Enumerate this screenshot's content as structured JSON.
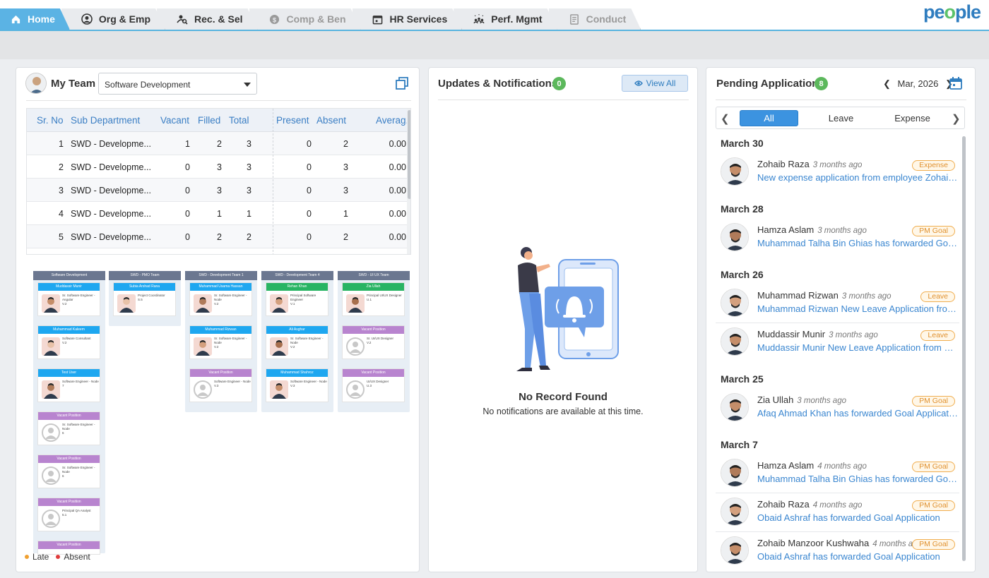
{
  "nav": {
    "tabs": [
      {
        "label": "Home",
        "icon": "home-icon",
        "state": "active"
      },
      {
        "label": "Org & Emp",
        "icon": "user-circle-icon",
        "state": "normal"
      },
      {
        "label": "Rec. & Sel",
        "icon": "user-search-icon",
        "state": "normal"
      },
      {
        "label": "Comp & Ben",
        "icon": "dollar-icon",
        "state": "disabled"
      },
      {
        "label": "HR Services",
        "icon": "calendar-icon",
        "state": "normal"
      },
      {
        "label": "Perf. Mgmt",
        "icon": "team-stars-icon",
        "state": "normal"
      },
      {
        "label": "Conduct",
        "icon": "document-icon",
        "state": "disabled"
      }
    ],
    "brand": {
      "pre": "pe",
      "mid": "o",
      "post": "ple"
    },
    "colors": {
      "active_tab": "#5bb3e4",
      "brand_blue": "#2f7dbf",
      "brand_green": "#5bc26a"
    }
  },
  "team": {
    "title": "My Team",
    "department": "Software Development",
    "columns": [
      "Sr. No",
      "Sub Department",
      "Vacant",
      "Filled",
      "Total",
      "Present",
      "Absent",
      "Averag..."
    ],
    "rows": [
      [
        "1",
        "SWD - Developme...",
        "1",
        "2",
        "3",
        "0",
        "2",
        "0.00"
      ],
      [
        "2",
        "SWD - Developme...",
        "0",
        "3",
        "3",
        "0",
        "3",
        "0.00"
      ],
      [
        "3",
        "SWD - Developme...",
        "0",
        "3",
        "3",
        "0",
        "3",
        "0.00"
      ],
      [
        "4",
        "SWD - Developme...",
        "0",
        "1",
        "1",
        "0",
        "1",
        "0.00"
      ],
      [
        "5",
        "SWD - Developme...",
        "0",
        "2",
        "2",
        "0",
        "2",
        "0.00"
      ]
    ],
    "org": [
      {
        "team": "Software Development",
        "members": [
          {
            "name": "Muddassir Munir",
            "role": "Sr. Software Engineer - Angular",
            "code": "V.2",
            "kind": "blue"
          },
          {
            "name": "Muhammad Kaleem",
            "role": "Software Consultant",
            "code": "V.2",
            "kind": "blue"
          },
          {
            "name": "Test User",
            "role": "Software Engineer - Node",
            "code": "7",
            "kind": "blue"
          },
          {
            "name": "Vacant Position",
            "role": "Sr. Software Engineer - Node",
            "code": "6",
            "kind": "vacant"
          },
          {
            "name": "Vacant Position",
            "role": "Sr. Software Engineer - Node",
            "code": "6",
            "kind": "vacant"
          },
          {
            "name": "Vacant Position",
            "role": "Principal QA Analyst",
            "code": "5.1",
            "kind": "vacant"
          },
          {
            "name": "Vacant Position",
            "role": "",
            "code": "",
            "kind": "vacant"
          }
        ]
      },
      {
        "team": "SWD - PMO Team",
        "members": [
          {
            "name": "Subia Arshad Rana",
            "role": "Project Coordinator",
            "code": "S.5",
            "kind": "blue"
          }
        ]
      },
      {
        "team": "SWD - Development Team 1",
        "members": [
          {
            "name": "Muhammad Usama Hassan",
            "role": "Sr. Software Engineer - Node",
            "code": "V.2",
            "kind": "blue"
          },
          {
            "name": "Muhammad Rizwan",
            "role": "Sr. Software Engineer - Node",
            "code": "V.2",
            "kind": "blue"
          },
          {
            "name": "Vacant Position",
            "role": "Software Engineer - Node",
            "code": "V.3",
            "kind": "vacant"
          }
        ]
      },
      {
        "team": "SWD - Development Team 4",
        "members": [
          {
            "name": "Rehan Khan",
            "role": "Principal Software Engineer",
            "code": "V.1",
            "kind": "green"
          },
          {
            "name": "Ali Asghar",
            "role": "Sr. Software Engineer - Node",
            "code": "V.2",
            "kind": "blue"
          },
          {
            "name": "Muhammad Shahroz",
            "role": "Software Engineer - Node",
            "code": "V.3",
            "kind": "blue"
          }
        ]
      },
      {
        "team": "SWD - UI UX Team",
        "members": [
          {
            "name": "Zia Ullah",
            "role": "Principal UI/UX Designer",
            "code": "U.1",
            "kind": "green"
          },
          {
            "name": "Vacant Position",
            "role": "Sr. UI/UX Designer",
            "code": "V.2",
            "kind": "vacant"
          },
          {
            "name": "Vacant Position",
            "role": "UI/UX Designer",
            "code": "U.3",
            "kind": "vacant"
          }
        ]
      }
    ],
    "legend": [
      {
        "label": "Late",
        "color": "#f0a030"
      },
      {
        "label": "Absent",
        "color": "#e03b3b"
      }
    ]
  },
  "updates": {
    "title": "Updates & Notifications",
    "count": "0",
    "view_all": "View All",
    "empty_title": "No Record Found",
    "empty_sub": "No notifications are available at this time."
  },
  "pending": {
    "title": "Pending Application",
    "count": "8",
    "month": "Mar, 2026",
    "filters": [
      "All",
      "Leave",
      "Expense"
    ],
    "groups": [
      {
        "date": "March 30",
        "items": [
          {
            "name": "Zohaib Raza",
            "ago": "3 months ago",
            "tag": "Expense",
            "msg": "New expense application from employee Zohaib R..."
          }
        ]
      },
      {
        "date": "March 28",
        "items": [
          {
            "name": "Hamza Aslam",
            "ago": "3 months ago",
            "tag": "PM Goal",
            "msg": "Muhammad Talha Bin Ghias has forwarded Goal ..."
          }
        ]
      },
      {
        "date": "March 26",
        "items": [
          {
            "name": "Muhammad Rizwan",
            "ago": "3 months ago",
            "tag": "Leave",
            "msg": "Muhammad Rizwan New Leave Application from ..."
          },
          {
            "name": "Muddassir Munir",
            "ago": "3 months ago",
            "tag": "Leave",
            "msg": "Muddassir Munir New Leave Application from Mu..."
          }
        ]
      },
      {
        "date": "March 25",
        "items": [
          {
            "name": "Zia Ullah",
            "ago": "3 months ago",
            "tag": "PM Goal",
            "msg": "Afaq Ahmad Khan has forwarded Goal Application"
          }
        ]
      },
      {
        "date": "March 7",
        "items": [
          {
            "name": "Hamza Aslam",
            "ago": "4 months ago",
            "tag": "PM Goal",
            "msg": "Muhammad Talha Bin Ghias has forwarded Goal ..."
          },
          {
            "name": "Zohaib Raza",
            "ago": "4 months ago",
            "tag": "PM Goal",
            "msg": "Obaid Ashraf has forwarded Goal Application"
          },
          {
            "name": "Zohaib Manzoor Kushwaha",
            "ago": "4 months a",
            "tag": "PM Goal",
            "msg": "Obaid Ashraf has forwarded Goal Application"
          }
        ]
      }
    ]
  }
}
